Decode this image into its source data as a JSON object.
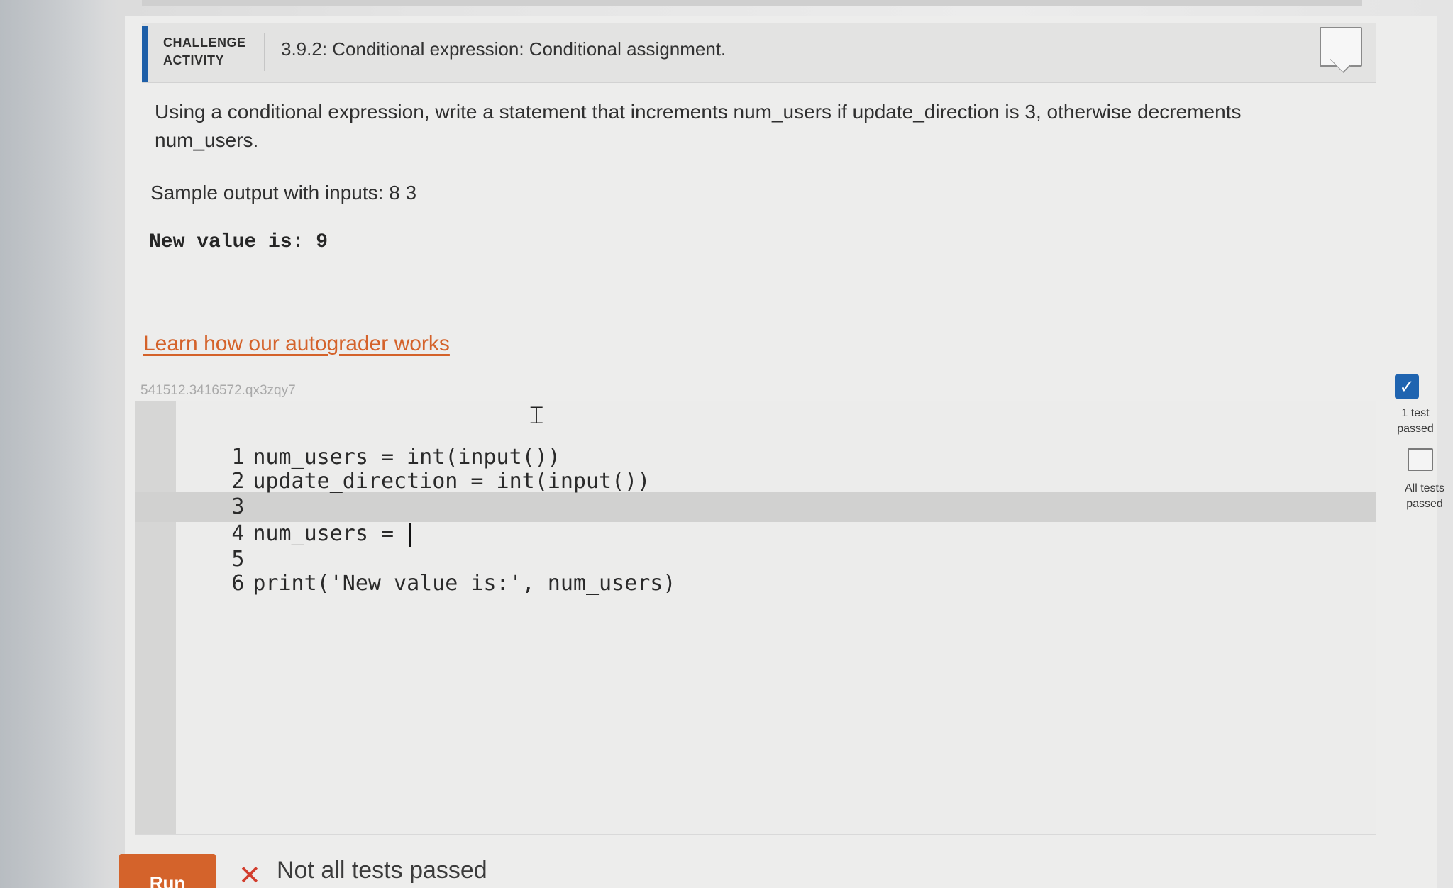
{
  "header": {
    "challenge_label": "CHALLENGE\nACTIVITY",
    "activity_title": "3.9.2: Conditional expression: Conditional assignment."
  },
  "prompt": {
    "text": "Using a conditional expression, write a statement that increments num_users if update_direction is 3, otherwise decrements num_users.",
    "sample_label": "Sample output with inputs: 8 3",
    "sample_output": "New value is: 9"
  },
  "learn_link": "Learn how our autograder works",
  "editor": {
    "id_label": "541512.3416572.qx3zqy7",
    "active_line": 4,
    "lines": [
      {
        "num": "1",
        "code": "num_users = int(input())"
      },
      {
        "num": "2",
        "code": "update_direction = int(input())"
      },
      {
        "num": "3",
        "code": ""
      },
      {
        "num": "4",
        "code": "num_users = "
      },
      {
        "num": "5",
        "code": ""
      },
      {
        "num": "6",
        "code": "print('New value is:', num_users)"
      }
    ]
  },
  "tests": {
    "test1_label": "1 test\npassed",
    "test1_passed": true,
    "all_label": "All tests\npassed",
    "all_passed": false
  },
  "footer": {
    "run_label": "Run",
    "result_text": "Not all tests passed"
  },
  "colors": {
    "accent": "#1e5fa8",
    "link": "#d4622a",
    "run_button": "#d4632b",
    "fail_icon": "#d23d2d"
  },
  "icons": {
    "check": "check-icon",
    "fail": "x-icon",
    "cursor": "text-cursor-icon"
  }
}
